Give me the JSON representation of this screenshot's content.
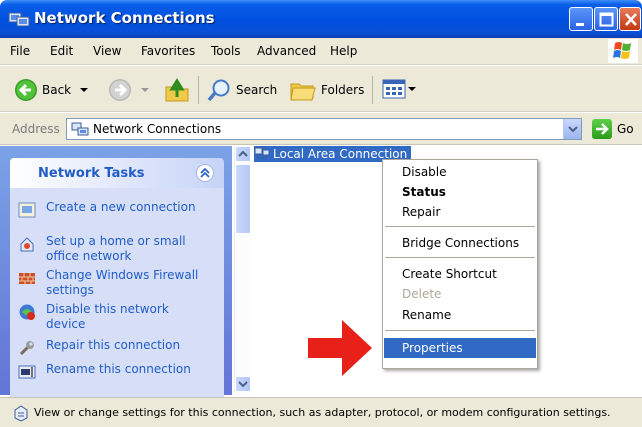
{
  "window": {
    "title": "Network Connections"
  },
  "menubar": {
    "items": [
      "File",
      "Edit",
      "View",
      "Favorites",
      "Tools",
      "Advanced",
      "Help"
    ]
  },
  "toolbar": {
    "back": "Back",
    "search": "Search",
    "folders": "Folders"
  },
  "address": {
    "label": "Address",
    "value": "Network Connections",
    "go": "Go"
  },
  "task_pane": {
    "title": "Network Tasks",
    "items": [
      {
        "label": "Create a new connection",
        "icon": "new-connection-icon"
      },
      {
        "label": "Set up a home or small office network",
        "icon": "home-network-icon"
      },
      {
        "label": "Change Windows Firewall settings",
        "icon": "firewall-icon"
      },
      {
        "label": "Disable this network device",
        "icon": "disable-device-icon"
      },
      {
        "label": "Repair this connection",
        "icon": "repair-icon"
      },
      {
        "label": "Rename this connection",
        "icon": "rename-icon"
      }
    ]
  },
  "content": {
    "connection": "Local Area Connection"
  },
  "context_menu": {
    "items": [
      {
        "label": "Disable",
        "state": "normal"
      },
      {
        "label": "Status",
        "state": "bold"
      },
      {
        "label": "Repair",
        "state": "normal"
      },
      {
        "label": "Bridge Connections",
        "state": "normal"
      },
      {
        "label": "Create Shortcut",
        "state": "normal"
      },
      {
        "label": "Delete",
        "state": "disabled"
      },
      {
        "label": "Rename",
        "state": "normal"
      },
      {
        "label": "Properties",
        "state": "selected"
      }
    ]
  },
  "status_bar": {
    "text": "View or change settings for this connection, such as adapter, protocol, or modem configuration settings."
  },
  "colors": {
    "title_blue": "#0051e0",
    "selection": "#316ac5",
    "task_link": "#215dc6",
    "arrow_red": "#e8201a"
  }
}
